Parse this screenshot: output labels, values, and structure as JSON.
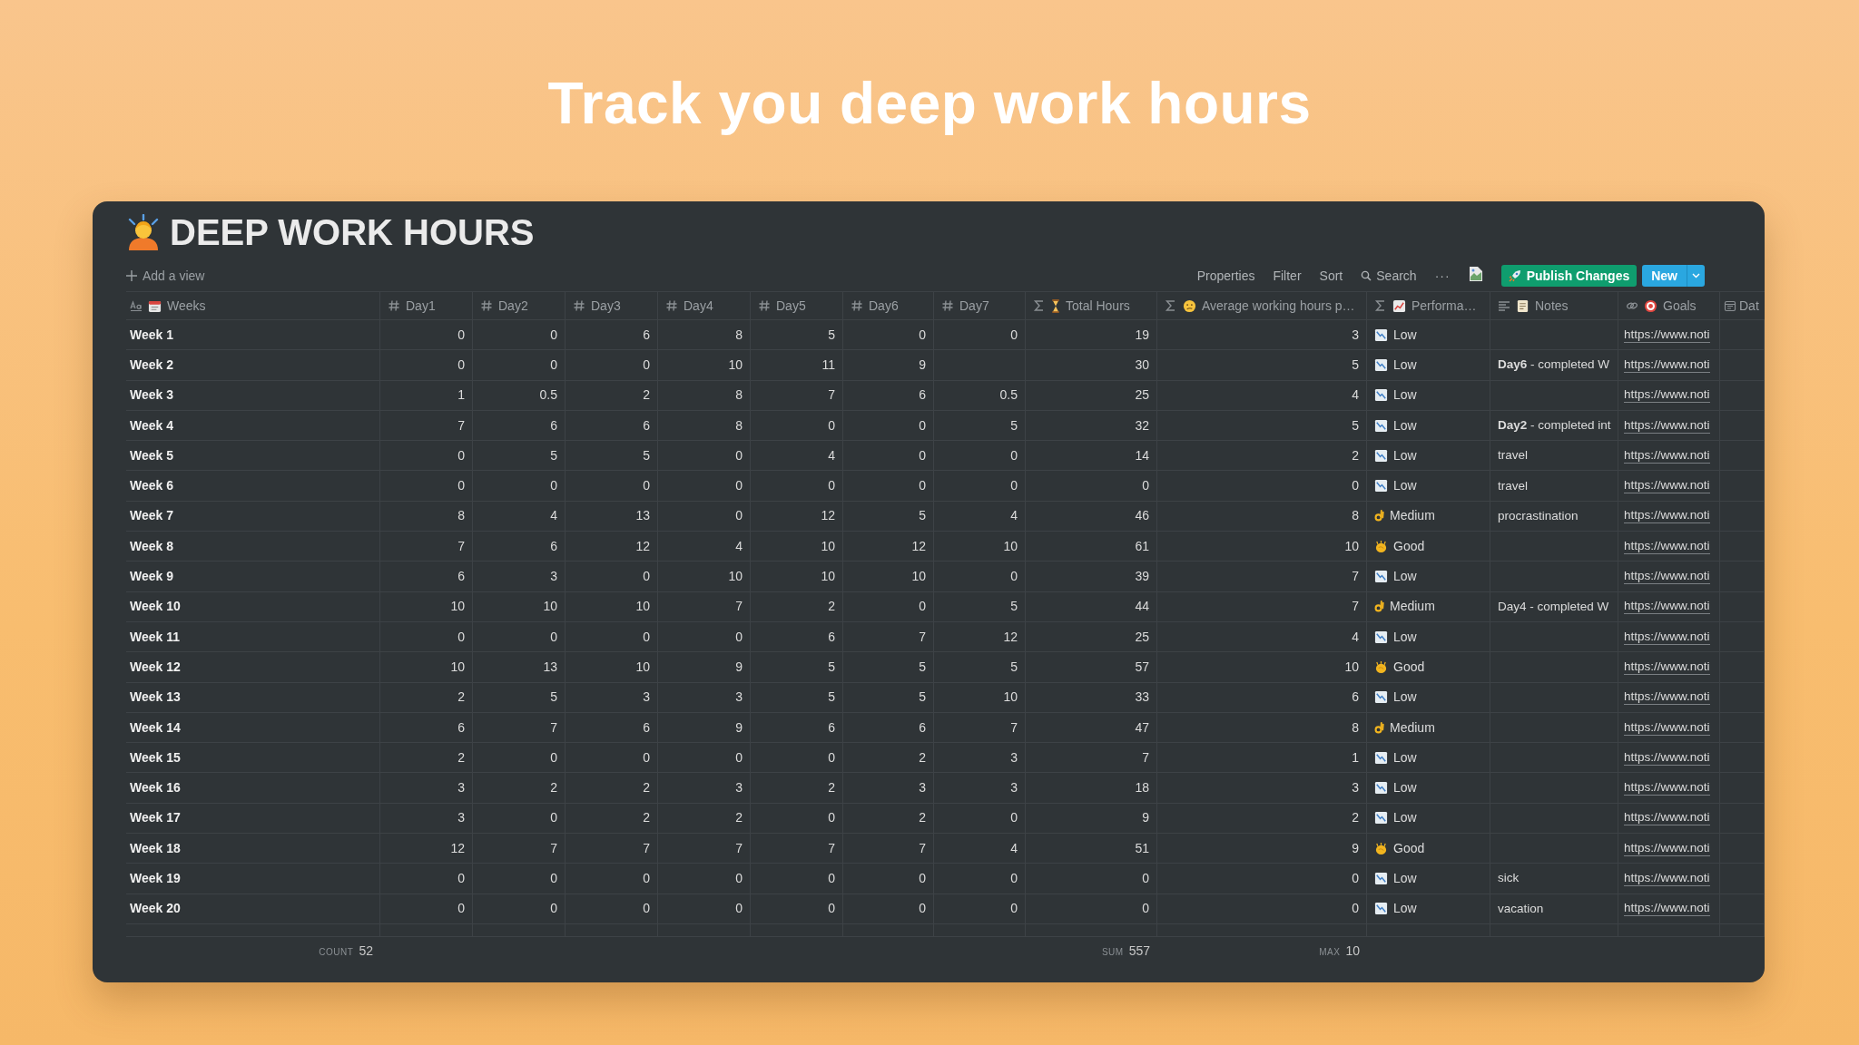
{
  "headline": "Track you deep work hours",
  "page": {
    "title": "DEEP WORK HOURS"
  },
  "toolbar": {
    "add_view": "Add a view",
    "items": [
      "Properties",
      "Filter",
      "Sort"
    ],
    "search": "Search",
    "more": "···",
    "publish": "Publish Changes",
    "new": "New"
  },
  "columns": [
    {
      "kind": "title",
      "emoji": {
        "kind": "calendar"
      },
      "label": "Weeks"
    },
    {
      "kind": "number",
      "label": "Day1"
    },
    {
      "kind": "number",
      "label": "Day2"
    },
    {
      "kind": "number",
      "label": "Day3"
    },
    {
      "kind": "number",
      "label": "Day4"
    },
    {
      "kind": "number",
      "label": "Day5"
    },
    {
      "kind": "number",
      "label": "Day6"
    },
    {
      "kind": "number",
      "label": "Day7"
    },
    {
      "kind": "formula",
      "emoji": {
        "kind": "hourglass"
      },
      "label": "Total Hours"
    },
    {
      "kind": "formula",
      "emoji": {
        "kind": "face"
      },
      "label": "Average working hours p…"
    },
    {
      "kind": "formula",
      "emoji": {
        "kind": "chart"
      },
      "label": "Performa…"
    },
    {
      "kind": "text",
      "emoji": {
        "kind": "memo"
      },
      "label": "Notes"
    },
    {
      "kind": "url",
      "emoji": {
        "kind": "target"
      },
      "label": "Goals"
    },
    {
      "kind": "date",
      "label": "Dat"
    }
  ],
  "rows": [
    {
      "week": "Week 1",
      "days": [
        "0",
        "0",
        "6",
        "8",
        "5",
        "0",
        "0"
      ],
      "total": "19",
      "avg": "3",
      "perf": {
        "kind": "low",
        "label": "Low"
      },
      "goal": "https://www.noti"
    },
    {
      "week": "Week 2",
      "days": [
        "0",
        "0",
        "0",
        "10",
        "11",
        "9"
      ],
      "total": "30",
      "avg": "5",
      "perf": {
        "kind": "low",
        "label": "Low"
      },
      "notes": "**Day6** - completed W",
      "goal": "https://www.noti"
    },
    {
      "week": "Week 3",
      "days": [
        "1",
        "0.5",
        "2",
        "8",
        "7",
        "6",
        "0.5"
      ],
      "total": "25",
      "avg": "4",
      "perf": {
        "kind": "low",
        "label": "Low"
      },
      "goal": "https://www.noti"
    },
    {
      "week": "Week 4",
      "days": [
        "7",
        "6",
        "6",
        "8",
        "0",
        "0",
        "5"
      ],
      "total": "32",
      "avg": "5",
      "perf": {
        "kind": "low",
        "label": "Low"
      },
      "notes": "**Day2** - completed int",
      "goal": "https://www.noti"
    },
    {
      "week": "Week 5",
      "days": [
        "0",
        "5",
        "5",
        "0",
        "4",
        "0",
        "0"
      ],
      "total": "14",
      "avg": "2",
      "perf": {
        "kind": "low",
        "label": "Low"
      },
      "notes": "travel",
      "goal": "https://www.noti"
    },
    {
      "week": "Week 6",
      "days": [
        "0",
        "0",
        "0",
        "0",
        "0",
        "0",
        "0"
      ],
      "total": "0",
      "avg": "0",
      "perf": {
        "kind": "low",
        "label": "Low"
      },
      "notes": "travel",
      "goal": "https://www.noti"
    },
    {
      "week": "Week 7",
      "days": [
        "8",
        "4",
        "13",
        "0",
        "12",
        "5",
        "4"
      ],
      "total": "46",
      "avg": "8",
      "perf": {
        "kind": "medium",
        "label": "Medium"
      },
      "notes": "procrastination",
      "goal": "https://www.noti"
    },
    {
      "week": "Week 8",
      "days": [
        "7",
        "6",
        "12",
        "4",
        "10",
        "12",
        "10"
      ],
      "total": "61",
      "avg": "10",
      "perf": {
        "kind": "good",
        "label": "Good"
      },
      "goal": "https://www.noti"
    },
    {
      "week": "Week 9",
      "days": [
        "6",
        "3",
        "0",
        "10",
        "10",
        "10",
        "0"
      ],
      "total": "39",
      "avg": "7",
      "perf": {
        "kind": "low",
        "label": "Low"
      },
      "goal": "https://www.noti"
    },
    {
      "week": "Week 10",
      "days": [
        "10",
        "10",
        "10",
        "7",
        "2",
        "0",
        "5"
      ],
      "total": "44",
      "avg": "7",
      "perf": {
        "kind": "medium",
        "label": "Medium"
      },
      "notes": "Day4 - completed W",
      "goal": "https://www.noti"
    },
    {
      "week": "Week 11",
      "days": [
        "0",
        "0",
        "0",
        "0",
        "6",
        "7",
        "12"
      ],
      "total": "25",
      "avg": "4",
      "perf": {
        "kind": "low",
        "label": "Low"
      },
      "goal": "https://www.noti"
    },
    {
      "week": "Week 12",
      "days": [
        "10",
        "13",
        "10",
        "9",
        "5",
        "5",
        "5"
      ],
      "total": "57",
      "avg": "10",
      "perf": {
        "kind": "good",
        "label": "Good"
      },
      "goal": "https://www.noti"
    },
    {
      "week": "Week 13",
      "days": [
        "2",
        "5",
        "3",
        "3",
        "5",
        "5",
        "10"
      ],
      "total": "33",
      "avg": "6",
      "perf": {
        "kind": "low",
        "label": "Low"
      },
      "goal": "https://www.noti"
    },
    {
      "week": "Week 14",
      "days": [
        "6",
        "7",
        "6",
        "9",
        "6",
        "6",
        "7"
      ],
      "total": "47",
      "avg": "8",
      "perf": {
        "kind": "medium",
        "label": "Medium"
      },
      "goal": "https://www.noti"
    },
    {
      "week": "Week 15",
      "days": [
        "2",
        "0",
        "0",
        "0",
        "0",
        "2",
        "3"
      ],
      "total": "7",
      "avg": "1",
      "perf": {
        "kind": "low",
        "label": "Low"
      },
      "goal": "https://www.noti"
    },
    {
      "week": "Week 16",
      "days": [
        "3",
        "2",
        "2",
        "3",
        "2",
        "3",
        "3"
      ],
      "total": "18",
      "avg": "3",
      "perf": {
        "kind": "low",
        "label": "Low"
      },
      "goal": "https://www.noti"
    },
    {
      "week": "Week 17",
      "days": [
        "3",
        "0",
        "2",
        "2",
        "0",
        "2",
        "0"
      ],
      "total": "9",
      "avg": "2",
      "perf": {
        "kind": "low",
        "label": "Low"
      },
      "goal": "https://www.noti"
    },
    {
      "week": "Week 18",
      "days": [
        "12",
        "7",
        "7",
        "7",
        "7",
        "7",
        "4"
      ],
      "total": "51",
      "avg": "9",
      "perf": {
        "kind": "good",
        "label": "Good"
      },
      "goal": "https://www.noti"
    },
    {
      "week": "Week 19",
      "days": [
        "0",
        "0",
        "0",
        "0",
        "0",
        "0",
        "0"
      ],
      "total": "0",
      "avg": "0",
      "perf": {
        "kind": "low",
        "label": "Low"
      },
      "notes": "sick",
      "goal": "https://www.noti"
    },
    {
      "week": "Week 20",
      "days": [
        "0",
        "0",
        "0",
        "0",
        "0",
        "0",
        "0"
      ],
      "total": "0",
      "avg": "0",
      "perf": {
        "kind": "low",
        "label": "Low"
      },
      "notes": "vacation",
      "goal": "https://www.noti"
    }
  ],
  "footer": {
    "count": {
      "label": "COUNT",
      "value": "52"
    },
    "sum": {
      "label": "SUM",
      "value": "557"
    },
    "max": {
      "label": "MAX",
      "value": "10"
    }
  }
}
